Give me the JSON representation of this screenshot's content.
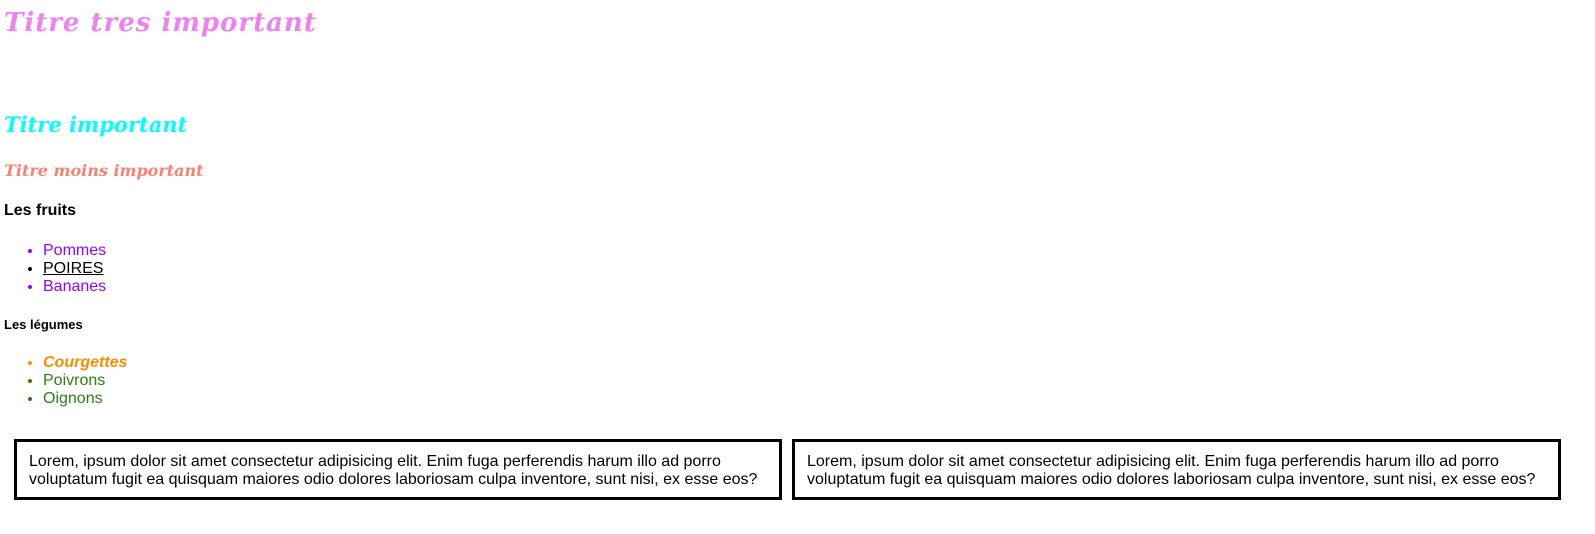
{
  "headings": {
    "h1": "Titre tres important",
    "h2": "Titre important",
    "h3": "Titre moins important",
    "fruits_title": "Les fruits",
    "legumes_title": "Les légumes"
  },
  "fruits": [
    "Pommes",
    "POIRES",
    "Bananes"
  ],
  "legumes": [
    "Courgettes",
    "Poivrons",
    "Oignons"
  ],
  "boxes": [
    "Lorem, ipsum dolor sit amet consectetur adipisicing elit. Enim fuga perferendis harum illo ad porro voluptatum fugit ea quisquam maiores odio dolores laboriosam culpa inventore, sunt nisi, ex esse eos?",
    "Lorem, ipsum dolor sit amet consectetur adipisicing elit. Enim fuga perferendis harum illo ad porro voluptatum fugit ea quisquam maiores odio dolores laboriosam culpa inventore, sunt nisi, ex esse eos?"
  ],
  "colors": {
    "h1": "#ee82ee",
    "h2": "#00ffff",
    "h3": "#fa8072",
    "fruits": "#9900ff",
    "courgettes": "#ff8c00",
    "legumes": "#2e7d12"
  }
}
